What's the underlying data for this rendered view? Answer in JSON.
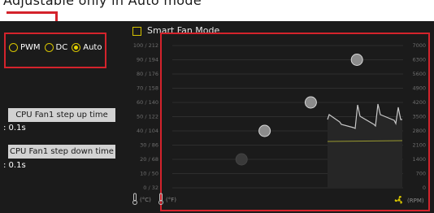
{
  "header": {
    "caption": "Adjustable only in Auto mode"
  },
  "mode_selector": {
    "options": [
      {
        "label": "PWM",
        "selected": false
      },
      {
        "label": "DC",
        "selected": false
      },
      {
        "label": "Auto",
        "selected": true
      }
    ]
  },
  "fan_step": {
    "up_label": "CPU Fan1 step up time",
    "up_value": ": 0.1s",
    "down_label": "CPU Fan1 step down time",
    "down_value": ": 0.1s"
  },
  "smart_fan": {
    "label": "Smart Fan Mode",
    "checked": false
  },
  "graph": {
    "temp_ticks": [
      "100 / 212",
      "90 / 194",
      "80 / 176",
      "70 / 158",
      "60 / 140",
      "50 / 122",
      "40 / 104",
      "30 / 86",
      "20 / 68",
      "10 / 50",
      "0 / 32"
    ],
    "rpm_ticks": [
      "7000",
      "6300",
      "5600",
      "4900",
      "4200",
      "3500",
      "2800",
      "2100",
      "1400",
      "700",
      "0"
    ],
    "temp_unit_c": "(°C)",
    "temp_unit_f": "(°F)",
    "rpm_unit": "(RPM)",
    "curve_points": [
      {
        "temp_c": 30,
        "rpm": 1400,
        "highlighted": false
      },
      {
        "temp_c": 40,
        "rpm": 2800,
        "highlighted": true
      },
      {
        "temp_c": 60,
        "rpm": 4200,
        "highlighted": true
      },
      {
        "temp_c": 80,
        "rpm": 6300,
        "highlighted": true
      }
    ],
    "colors": {
      "accent": "#d4232c",
      "radio": "#d6c300",
      "monitor_line": "#c8c8c8",
      "temp_line": "#9a9a30"
    }
  }
}
